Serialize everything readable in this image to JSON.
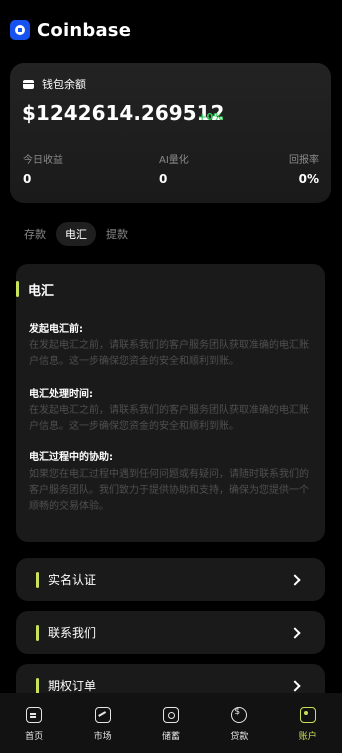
{
  "app": {
    "brand": "Coinbase"
  },
  "wallet": {
    "title": "钱包余额",
    "balance": "$1242614.269512",
    "change": "+0%",
    "stats": [
      {
        "label": "今日收益",
        "value": "0"
      },
      {
        "label": "AI量化",
        "value": "0"
      },
      {
        "label": "回报率",
        "value": "0%"
      }
    ]
  },
  "tabs": [
    {
      "label": "存款",
      "active": false
    },
    {
      "label": "电汇",
      "active": true
    },
    {
      "label": "提款",
      "active": false
    }
  ],
  "panel": {
    "title": "电汇",
    "sections": [
      {
        "title": "发起电汇前:",
        "body": "在发起电汇之前，请联系我们的客户服务团队获取准确的电汇账户信息。这一步确保您资金的安全和顺利到账。"
      },
      {
        "title": "电汇处理时间:",
        "body": "在发起电汇之前，请联系我们的客户服务团队获取准确的电汇账户信息。这一步确保您资金的安全和顺利到账。"
      },
      {
        "title": "电汇过程中的协助:",
        "body": "如果您在电汇过程中遇到任何问题或有疑问，请随时联系我们的客户服务团队。我们致力于提供协助和支持，确保为您提供一个顺畅的交易体验。"
      }
    ]
  },
  "menu": [
    {
      "label": "实名认证"
    },
    {
      "label": "联系我们"
    },
    {
      "label": "期权订单"
    }
  ],
  "nav": [
    {
      "label": "首页",
      "icon": "home-icon"
    },
    {
      "label": "市场",
      "icon": "market-icon"
    },
    {
      "label": "储蓄",
      "icon": "savings-icon"
    },
    {
      "label": "贷款",
      "icon": "loan-icon"
    },
    {
      "label": "账户",
      "icon": "account-icon",
      "active": true
    }
  ],
  "colors": {
    "accent": "#c8e35a",
    "positive": "#34c759",
    "brand": "#1652f0"
  }
}
